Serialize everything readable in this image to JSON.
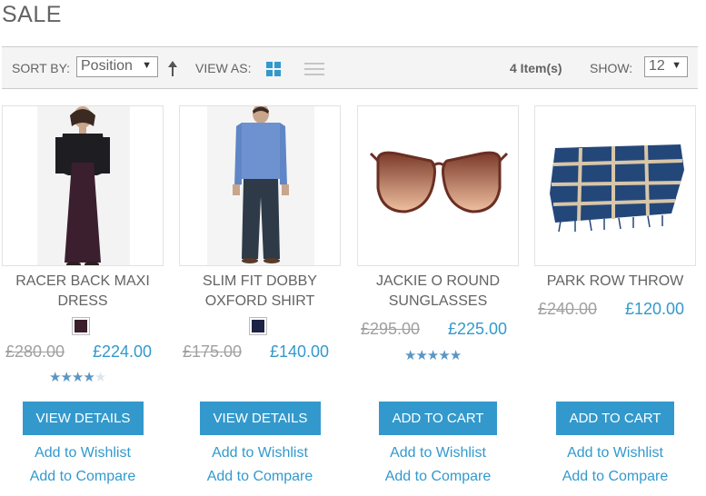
{
  "page": {
    "title": "SALE"
  },
  "toolbar": {
    "sort_label": "SORT BY:",
    "sort_value": "Position",
    "view_label": "VIEW AS:",
    "count": "4 Item(s)",
    "show_label": "SHOW:",
    "show_value": "12",
    "accent_color": "#3399cc"
  },
  "products": [
    {
      "name_line1": "RACER BACK MAXI",
      "name_line2": "DRESS",
      "swatch_color": "#3b1f2b",
      "old_price": "£280.00",
      "new_price": "£224.00",
      "rating": 4,
      "rating_max": 5,
      "button": "VIEW DETAILS",
      "wishlist": "Add to Wishlist",
      "compare": "Add to Compare"
    },
    {
      "name_line1": "SLIM FIT DOBBY",
      "name_line2": "OXFORD SHIRT",
      "swatch_color": "#1d2345",
      "old_price": "£175.00",
      "new_price": "£140.00",
      "button": "VIEW DETAILS",
      "wishlist": "Add to Wishlist",
      "compare": "Add to Compare"
    },
    {
      "name_line1": "JACKIE O ROUND",
      "name_line2": "SUNGLASSES",
      "old_price": "£295.00",
      "new_price": "£225.00",
      "rating": 5,
      "rating_max": 5,
      "button": "ADD TO CART",
      "wishlist": "Add to Wishlist",
      "compare": "Add to Compare"
    },
    {
      "name_line1": "PARK ROW THROW",
      "old_price": "£240.00",
      "new_price": "£120.00",
      "button": "ADD TO CART",
      "wishlist": "Add to Wishlist",
      "compare": "Add to Compare"
    }
  ],
  "icons": [
    "sort-direction-arrow-icon",
    "grid-view-icon",
    "list-view-icon",
    "select-caret-icon",
    "star-icon"
  ]
}
